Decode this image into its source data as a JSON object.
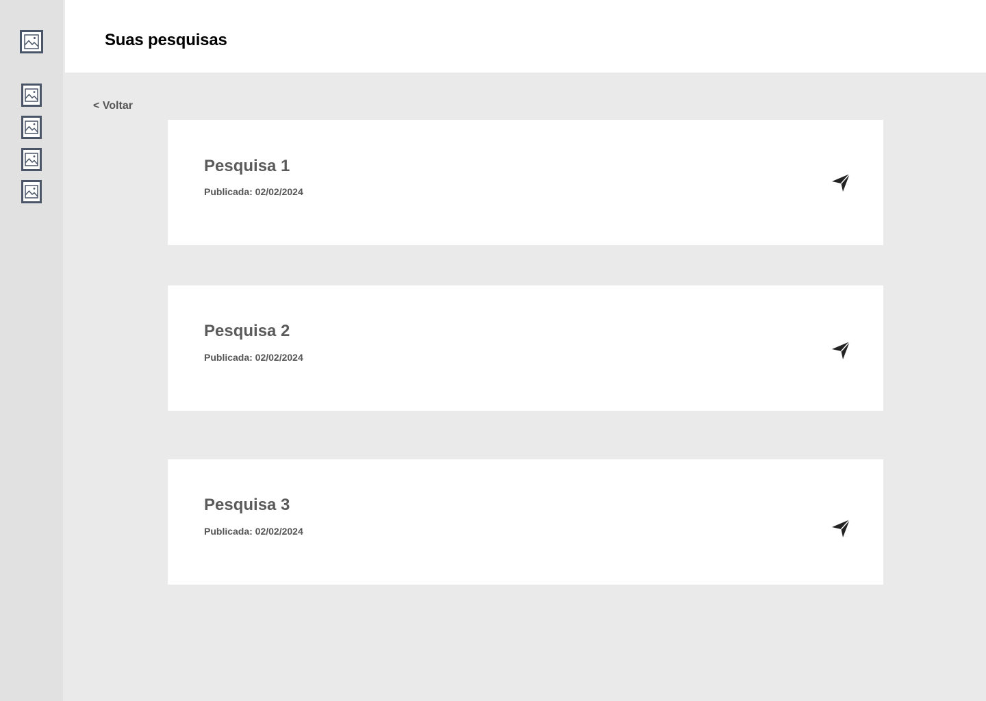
{
  "sidebar": {
    "icons": [
      {
        "name": "logo-image-icon"
      },
      {
        "name": "nav-image-icon-1"
      },
      {
        "name": "nav-image-icon-2"
      },
      {
        "name": "nav-image-icon-3"
      },
      {
        "name": "nav-image-icon-4"
      }
    ],
    "icon_color": "#4a5568"
  },
  "header": {
    "title": "Suas pesquisas"
  },
  "back_link": {
    "label": "< Voltar"
  },
  "surveys": [
    {
      "title": "Pesquisa 1",
      "published": "Publicada: 02/02/2024",
      "action_icon": "send-icon"
    },
    {
      "title": "Pesquisa 2",
      "published": "Publicada: 02/02/2024",
      "action_icon": "send-icon"
    },
    {
      "title": "Pesquisa 3",
      "published": "Publicada: 02/02/2024",
      "action_icon": "send-icon"
    }
  ],
  "colors": {
    "background": "#eaeaea",
    "sidebar": "#e1e1e1",
    "card": "#ffffff",
    "title_text": "#000000",
    "muted_text": "#555555"
  }
}
